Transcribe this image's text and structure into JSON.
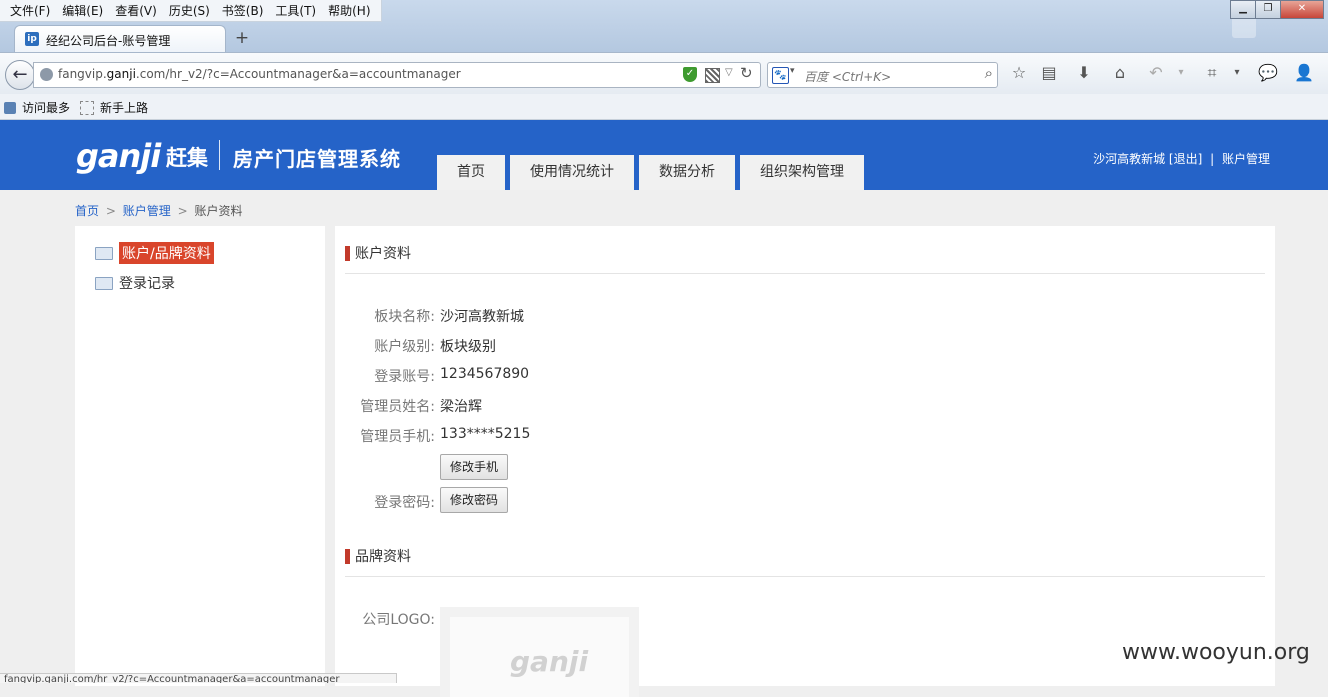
{
  "browser": {
    "menus": [
      "文件(F)",
      "编辑(E)",
      "查看(V)",
      "历史(S)",
      "书签(B)",
      "工具(T)",
      "帮助(H)"
    ],
    "tab_title": "经纪公司后台-账号管理",
    "favicon_text": "ip",
    "url_prefix": "fangvip.",
    "url_domain": "ganji",
    "url_suffix": ".com/hr_v2/?c=Accountmanager&a=accountmanager",
    "search_placeholder": "百度 <Ctrl+K>",
    "bookmarks": [
      "访问最多",
      "新手上路"
    ],
    "status_text": "fangvip.ganji.com/hr_v2/?c=Accountmanager&a=accountmanager"
  },
  "site": {
    "logo_text": "ganji",
    "logo_cn": "赶集",
    "system_title": "房产门店管理系统",
    "nav_tabs": [
      "首页",
      "使用情况统计",
      "数据分析",
      "组织架构管理"
    ],
    "user_name": "沙河高教新城",
    "logout": "[退出]",
    "separator": "|",
    "account_mgmt": "账户管理"
  },
  "breadcrumb": {
    "home": "首页",
    "section": "账户管理",
    "current": "账户资料",
    "sep": ">"
  },
  "sidebar": {
    "items": [
      "账户/品牌资料",
      "登录记录"
    ]
  },
  "account": {
    "section_title": "账户资料",
    "fields": [
      {
        "label": "板块名称:",
        "value": "沙河高教新城"
      },
      {
        "label": "账户级别:",
        "value": "板块级别"
      },
      {
        "label": "登录账号:",
        "value": "1234567890"
      },
      {
        "label": "管理员姓名:",
        "value": "梁治辉"
      },
      {
        "label": "管理员手机:",
        "value": "133****5215"
      }
    ],
    "change_phone_btn": "修改手机",
    "password_label": "登录密码:",
    "change_password_btn": "修改密码"
  },
  "brand": {
    "section_title": "品牌资料",
    "logo_label": "公司LOGO:",
    "logo_placeholder": "ganji"
  },
  "watermark": "www.wooyun.org"
}
